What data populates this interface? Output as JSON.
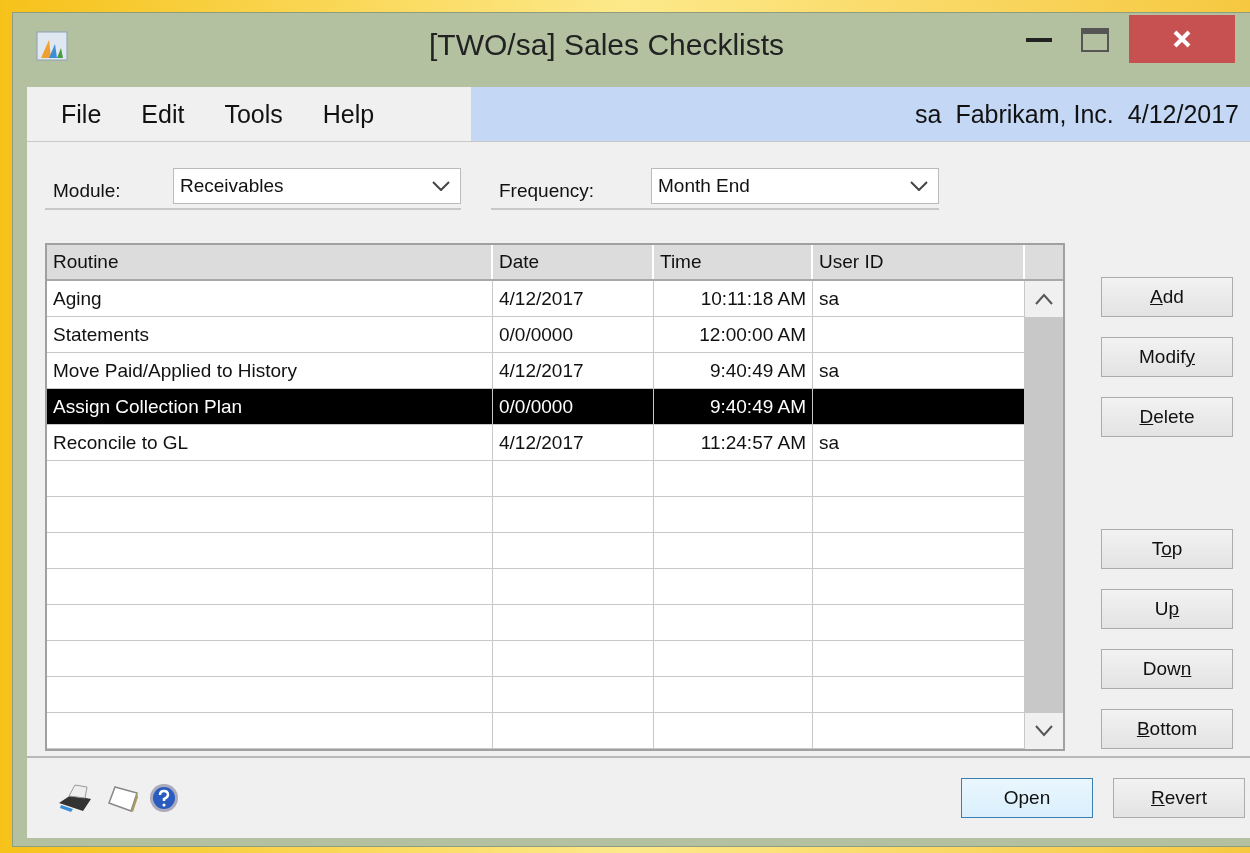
{
  "window": {
    "title": "[TWO/sa] Sales Checklists"
  },
  "menu": [
    "File",
    "Edit",
    "Tools",
    "Help"
  ],
  "status_info": {
    "user": "sa",
    "company": "Fabrikam, Inc.",
    "date": "4/12/2017"
  },
  "module": {
    "label": "Module:",
    "value": "Receivables"
  },
  "frequency": {
    "label": "Frequency:",
    "value": "Month End"
  },
  "table": {
    "columns": [
      "Routine",
      "Date",
      "Time",
      "User ID"
    ],
    "rows": [
      {
        "routine": "Aging",
        "date": "4/12/2017",
        "time": "10:11:18 AM",
        "user": "sa",
        "selected": false
      },
      {
        "routine": "Statements",
        "date": "0/0/0000",
        "time": "12:00:00 AM",
        "user": "",
        "selected": false
      },
      {
        "routine": "Move Paid/Applied to History",
        "date": "4/12/2017",
        "time": "9:40:49 AM",
        "user": "sa",
        "selected": false
      },
      {
        "routine": "Assign Collection Plan",
        "date": "0/0/0000",
        "time": "9:40:49 AM",
        "user": "",
        "selected": true
      },
      {
        "routine": "Reconcile to GL",
        "date": "4/12/2017",
        "time": "11:24:57 AM",
        "user": "sa",
        "selected": false
      }
    ]
  },
  "side_buttons": [
    {
      "key": "A",
      "post": "dd"
    },
    {
      "pre": "Modif",
      "key": "y"
    },
    {
      "key": "D",
      "post": "elete"
    },
    {
      "pre": "T",
      "key": "o",
      "post": "p"
    },
    {
      "pre": "U",
      "key": "p"
    },
    {
      "pre": "Dow",
      "key": "n"
    },
    {
      "key": "B",
      "post": "ottom"
    }
  ],
  "footer_buttons": [
    {
      "pre": "Open",
      "default": true
    },
    {
      "key": "R",
      "post": "evert",
      "default": false
    }
  ]
}
